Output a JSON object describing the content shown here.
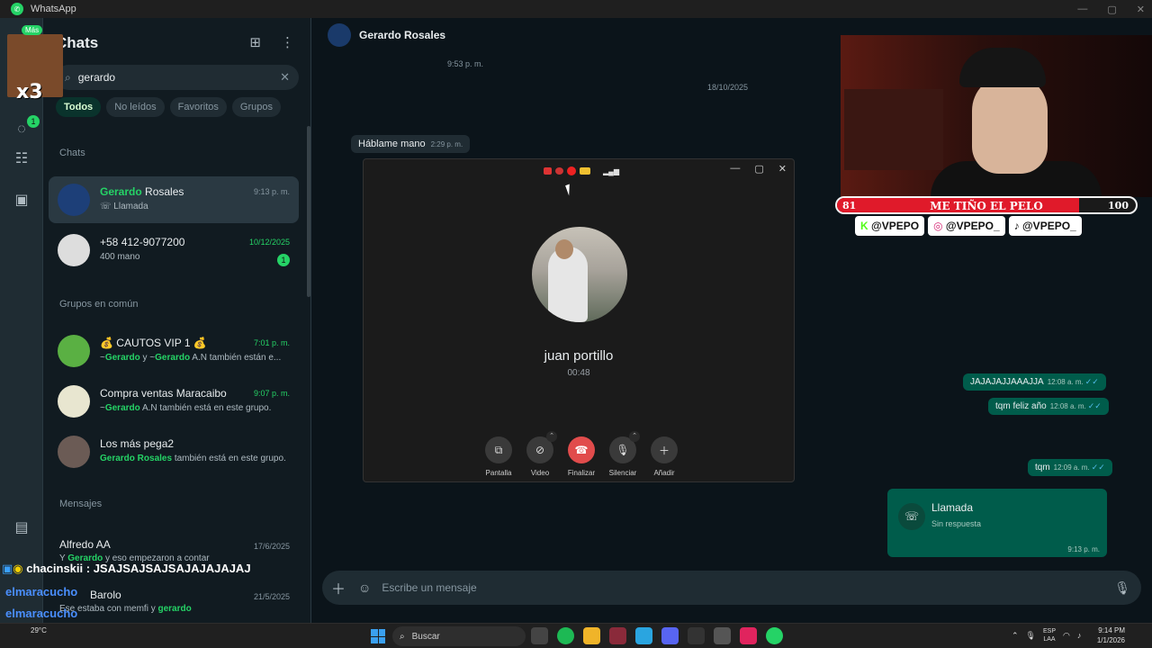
{
  "window": {
    "app_name": "WhatsApp"
  },
  "sidebar": {
    "title": "Chats",
    "search": {
      "value": "gerardo",
      "placeholder": ""
    },
    "filters": [
      "Todos",
      "No leídos",
      "Favoritos",
      "Grupos"
    ],
    "section_chats": "Chats",
    "section_groups": "Grupos en común",
    "section_messages": "Mensajes",
    "chats": [
      {
        "name_hl": "Gerardo",
        "name_rest": " Rosales",
        "sub": "Llamada",
        "time": "9:13 p. m."
      },
      {
        "name": "+58 412-9077200",
        "sub": "400 mano",
        "time": "10/12/2025",
        "unread": "1"
      }
    ],
    "groups": [
      {
        "name": "💰 CAUTOS VIP 1 💰",
        "sub_pre": "~",
        "sub_hl1": "Gerardo",
        "sub_mid": " y ~",
        "sub_hl2": "Gerardo",
        "sub_post": " A.N también están e...",
        "time": "7:01 p. m."
      },
      {
        "name": "Compra ventas Maracaibo",
        "sub_pre": "~",
        "sub_hl1": "Gerardo",
        "sub_post": " A.N también está en este grupo.",
        "time": "9:07 p. m."
      },
      {
        "name": "Los más pega2",
        "sub_hl1": "Gerardo",
        "sub_mid": " Rosales",
        "sub_post": " también está en este grupo."
      }
    ],
    "messages": [
      {
        "name": "Alfredo AA",
        "time": "17/6/2025",
        "sub_pre": "Y ",
        "sub_hl": "Gerardo",
        "sub_post": " y eso empezaron a contar"
      },
      {
        "name": "Barolo",
        "time": "21/5/2025",
        "sub_pre": "Ese estaba con memfi y ",
        "sub_hl": "gerardo"
      }
    ],
    "rail_badge_status": "1"
  },
  "main": {
    "contact_name": "Gerardo Rosales",
    "top_time": "9:53 p. m.",
    "date_divider": "18/10/2025",
    "incoming": [
      {
        "text": "Háblame mano",
        "time": "2:29 p. m."
      }
    ],
    "outgoing": [
      {
        "text": "JAJAJAJJAAAJJA",
        "time": "12:08 a. m."
      },
      {
        "text": "tqm feliz año",
        "time": "12:08 a. m."
      },
      {
        "text": "tqm",
        "time": "12:09 a. m."
      }
    ],
    "call_bubble": {
      "title": "Llamada",
      "sub": "Sin respuesta",
      "time": "9:13 p. m."
    },
    "composer_placeholder": "Escribe un mensaje"
  },
  "call": {
    "name": "juan portillo",
    "duration": "00:48",
    "buttons": [
      "Pantalla",
      "Video",
      "Finalizar",
      "Silenciar",
      "Añadir"
    ]
  },
  "stream": {
    "emote_label": "Más",
    "emote_multiplier": "x3",
    "goal": {
      "left": "81",
      "title": "ME TIÑO EL PELO",
      "right": "100",
      "progress": 0.81
    },
    "socials": [
      "@VPEPO",
      "@VPEPO_",
      "@VPEPO_"
    ],
    "chat": [
      {
        "user": "chacinskii",
        "text": " : JSAJSAJSAJSAJAJAJAJAJ"
      },
      {
        "user": "elmaracucho",
        "text": ""
      },
      {
        "user": "elmaracucho",
        "text": ""
      },
      {
        "user": "elmaracucho",
        "text": ""
      }
    ]
  },
  "taskbar": {
    "weather": "29°C",
    "search_label": "Buscar",
    "lang_top": "ESP",
    "lang_bottom": "LAA",
    "time": "9:14 PM",
    "date": "1/1/2026"
  },
  "colors": {
    "accent": "#25d366",
    "outgoing": "#005c4b",
    "end_call": "#e14c4c",
    "goal_fill": "#e01a2a"
  }
}
